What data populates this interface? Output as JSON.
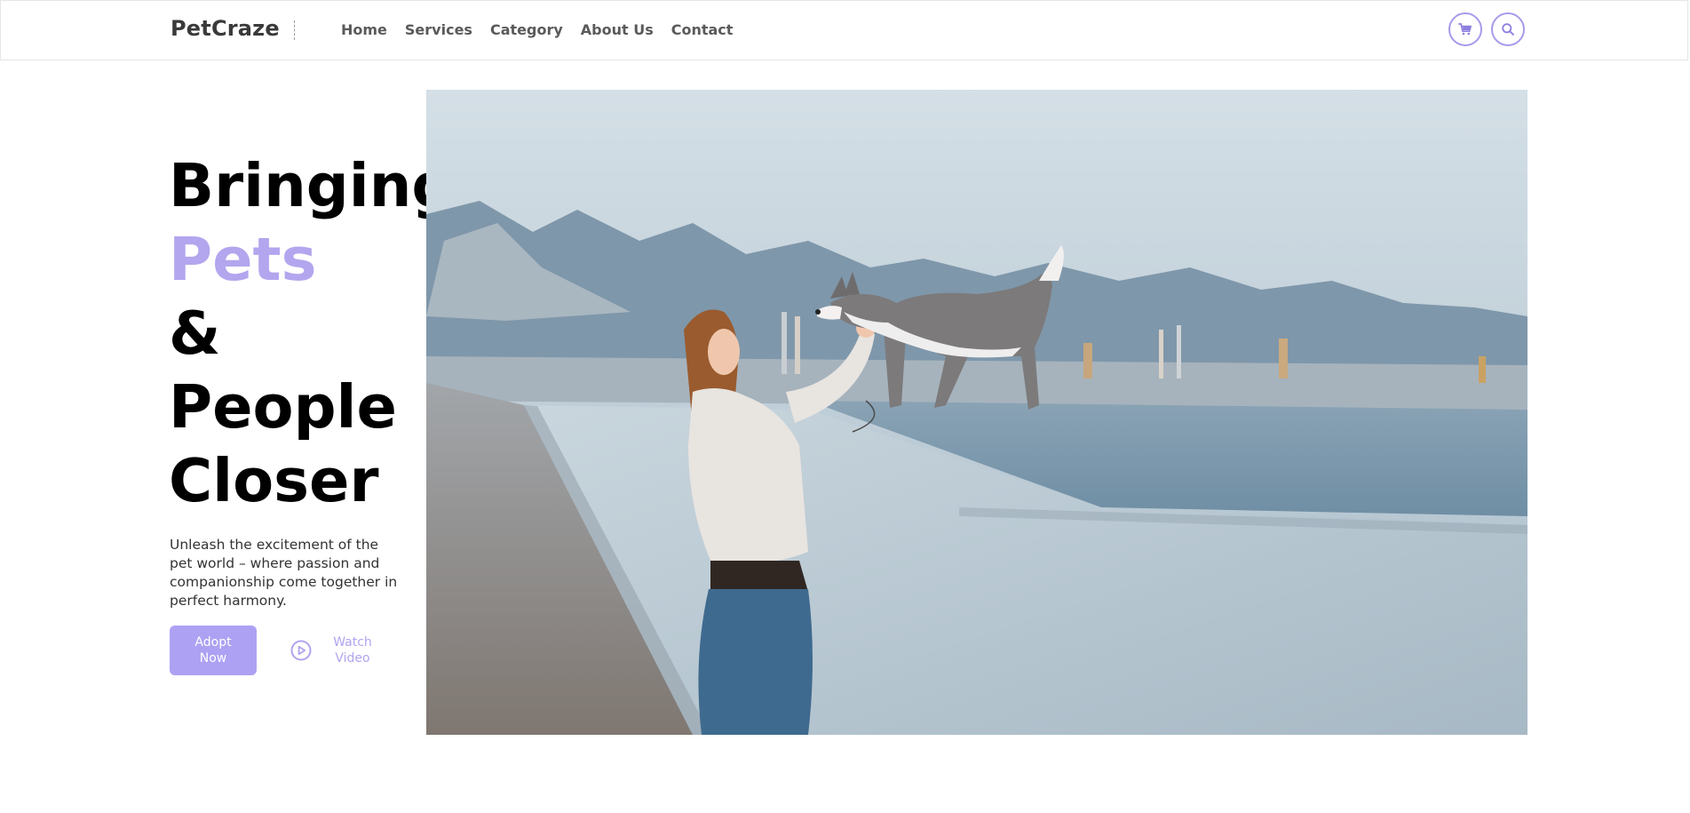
{
  "brand": {
    "name": "PetCraze"
  },
  "nav": {
    "links": [
      "Home",
      "Services",
      "Category",
      "About Us",
      "Contact"
    ],
    "icons": {
      "cart": "cart-icon",
      "search": "search-icon"
    }
  },
  "hero": {
    "title_lines": [
      "Bringing",
      "Pets",
      "&",
      "People",
      "Closer"
    ],
    "description": "Unleash the excitement of the pet world – where passion and companionship come together in perfect harmony.",
    "adopt_label": "Adopt Now",
    "watch_label": "Watch Video",
    "watch_icon": "play-circle-icon"
  },
  "colors": {
    "accent": "#b3a6ee",
    "button_bg": "#ada1f3",
    "text_dark": "#000000",
    "nav_text": "#5a5a5a"
  }
}
